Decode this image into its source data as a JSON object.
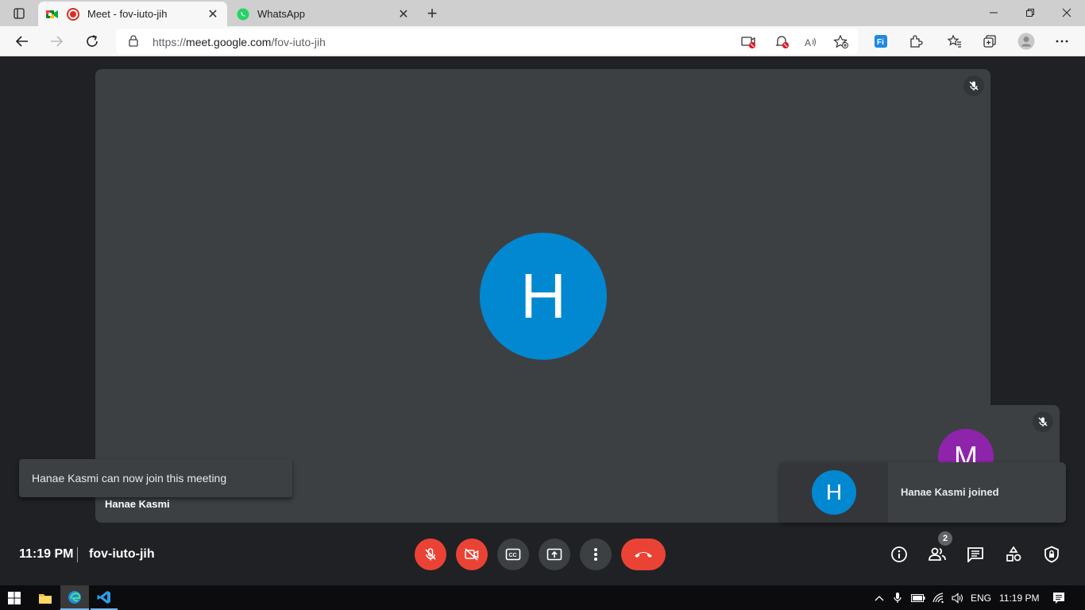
{
  "browser": {
    "tabs": [
      {
        "title": "Meet - fov-iuto-jih",
        "active": true
      },
      {
        "title": "WhatsApp",
        "active": false
      }
    ],
    "address_bar": {
      "scheme": "https://",
      "host": "meet.google.com",
      "path": "/fov-iuto-jih"
    }
  },
  "meeting": {
    "main_participant": {
      "initial": "H",
      "name": "Hanae Kasmi",
      "color": "#0288d1"
    },
    "self_participant": {
      "initial": "M",
      "color": "#8e24aa"
    },
    "join_notification": {
      "initial": "H",
      "message": "Hanae Kasmi joined"
    },
    "snackbar": "Hanae Kasmi can now join this meeting",
    "time": "11:19 PM",
    "code": "fov-iuto-jih",
    "people_count": "2",
    "accent_red": "#ea4335"
  },
  "taskbar": {
    "language": "ENG",
    "time": "11:19 PM"
  }
}
